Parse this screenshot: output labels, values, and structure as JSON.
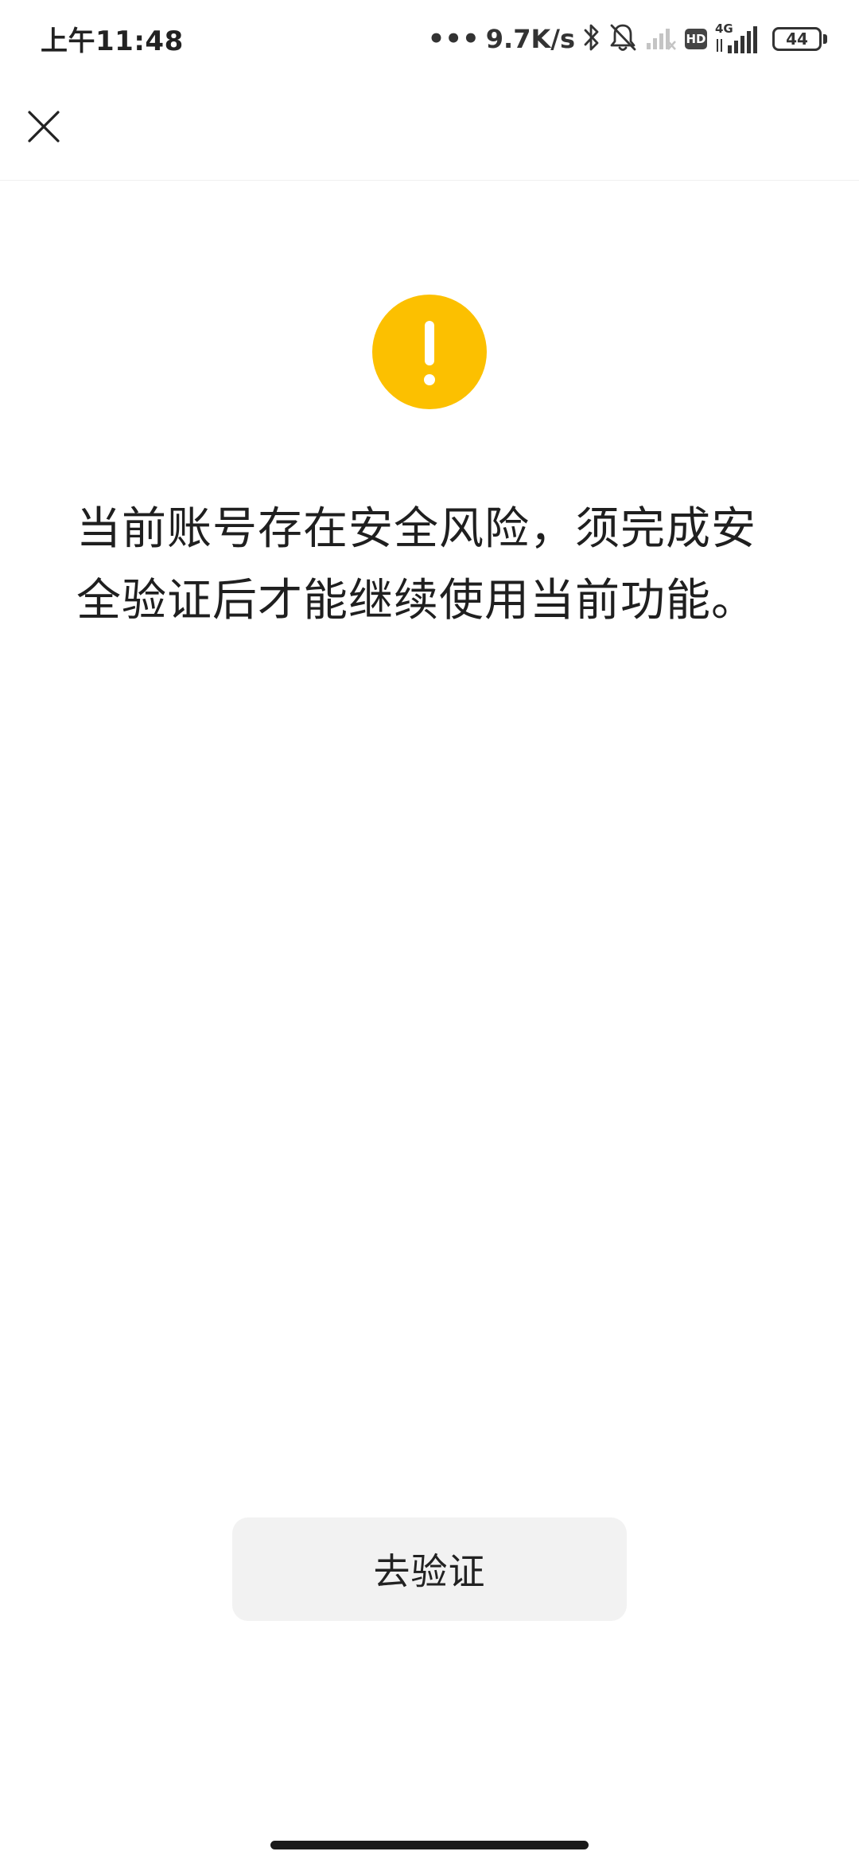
{
  "status_bar": {
    "time": "上午11:48",
    "dots": "•••",
    "net_speed": "9.7K/s",
    "hd_label": "HD",
    "network_type": "4G",
    "battery_level": "44",
    "icons": [
      "bluetooth-icon",
      "bell-muted-icon",
      "signal-weak-icon",
      "hd-icon",
      "signal-4g-icon",
      "battery-icon"
    ]
  },
  "nav": {
    "close_icon": "close-icon"
  },
  "warning": {
    "icon": "exclamation-icon",
    "color": "#fcc000",
    "message_line1": "当前账号存在安全风险，须完成安",
    "message_line2": "全验证后才能继续使用当前功能。"
  },
  "actions": {
    "verify_label": "去验证"
  }
}
